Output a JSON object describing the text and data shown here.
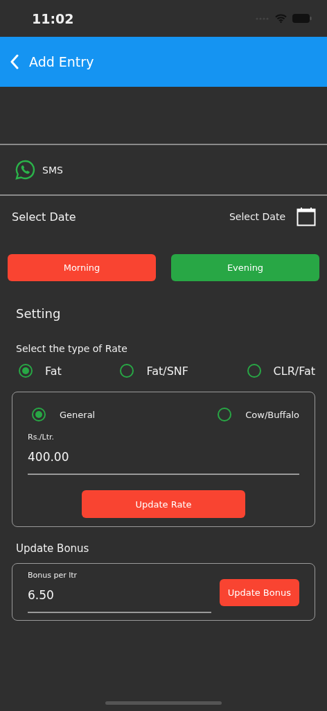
{
  "status_bar": {
    "time": "11:02"
  },
  "header": {
    "title": "Add Entry"
  },
  "sms": {
    "label": "SMS"
  },
  "date": {
    "label": "Select Date",
    "value": "Select Date"
  },
  "shifts": [
    {
      "label": "Morning",
      "color": "#f94431"
    },
    {
      "label": "Evening",
      "color": "#28a745"
    }
  ],
  "setting": {
    "title": "Setting",
    "rate_type_label": "Select the type of Rate",
    "rate_types": [
      {
        "label": "Fat",
        "selected": true
      },
      {
        "label": "Fat/SNF",
        "selected": false
      },
      {
        "label": "CLR/Fat",
        "selected": false
      }
    ],
    "categories": [
      {
        "label": "General",
        "selected": true
      },
      {
        "label": "Cow/Buffalo",
        "selected": false
      }
    ],
    "rate_field": {
      "label": "Rs./Ltr.",
      "value": "400.00"
    },
    "update_rate_button": "Update Rate"
  },
  "bonus": {
    "title": "Update Bonus",
    "field": {
      "label": "Bonus per ltr",
      "value": "6.50"
    },
    "button": "Update Bonus"
  }
}
